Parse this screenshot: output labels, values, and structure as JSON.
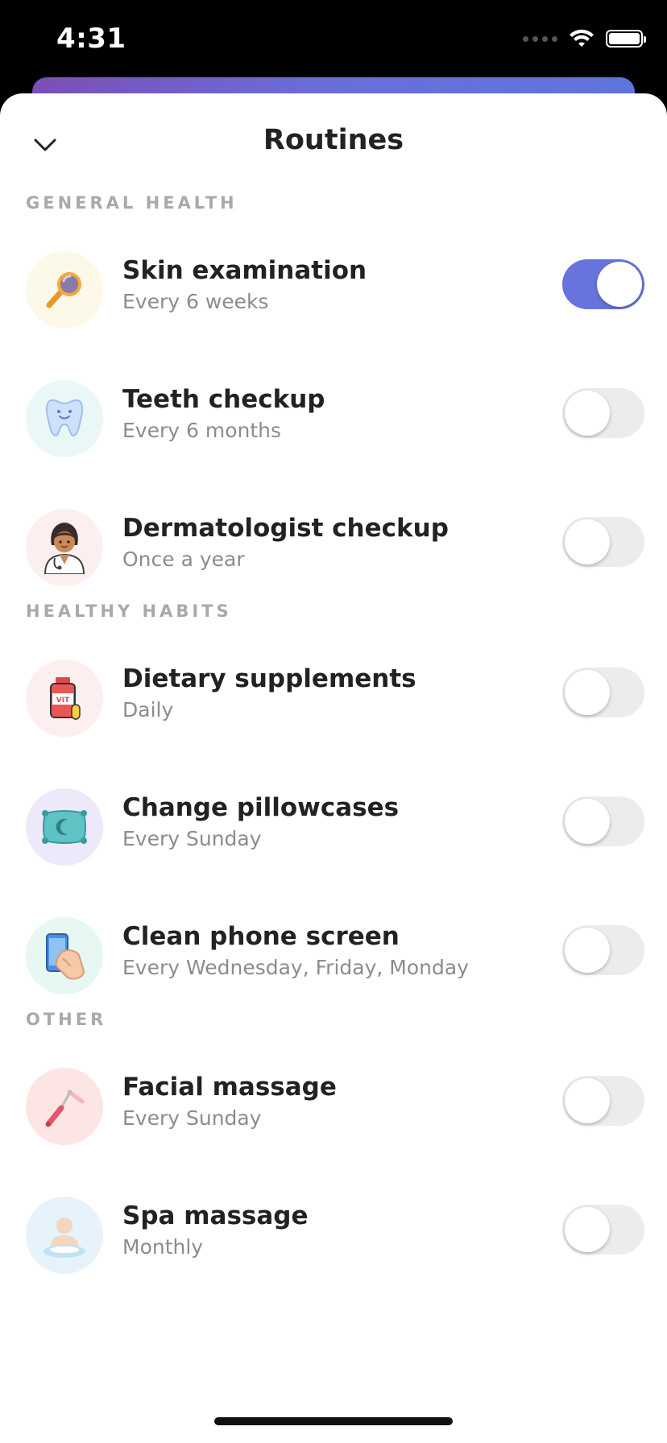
{
  "status": {
    "time": "4:31"
  },
  "header": {
    "title": "Routines",
    "close_icon": "chevron-down-icon"
  },
  "sections": [
    {
      "title": "GENERAL HEALTH",
      "items": [
        {
          "title": "Skin examination",
          "subtitle": "Every 6 weeks",
          "icon": "magnifier-icon",
          "enabled": true
        },
        {
          "title": "Teeth checkup",
          "subtitle": "Every 6 months",
          "icon": "tooth-icon",
          "enabled": false
        },
        {
          "title": "Dermatologist checkup",
          "subtitle": "Once a year",
          "icon": "doctor-icon",
          "enabled": false
        }
      ]
    },
    {
      "title": "HEALTHY HABITS",
      "items": [
        {
          "title": "Dietary supplements",
          "subtitle": "Daily",
          "icon": "vitamin-bottle-icon",
          "enabled": false
        },
        {
          "title": "Change pillowcases",
          "subtitle": "Every Sunday",
          "icon": "pillow-icon",
          "enabled": false
        },
        {
          "title": "Clean phone screen",
          "subtitle": "Every Wednesday, Friday, Monday",
          "icon": "phone-cleaning-icon",
          "enabled": false
        }
      ]
    },
    {
      "title": "OTHER",
      "items": [
        {
          "title": "Facial massage",
          "subtitle": "Every Sunday",
          "icon": "face-roller-icon",
          "enabled": false
        },
        {
          "title": "Spa massage",
          "subtitle": "Monthly",
          "icon": "spa-person-icon",
          "enabled": false
        }
      ]
    }
  ],
  "colors": {
    "accent": "#6874dd",
    "toggle_off": "#ececef",
    "section_label": "#a9a9ad"
  }
}
